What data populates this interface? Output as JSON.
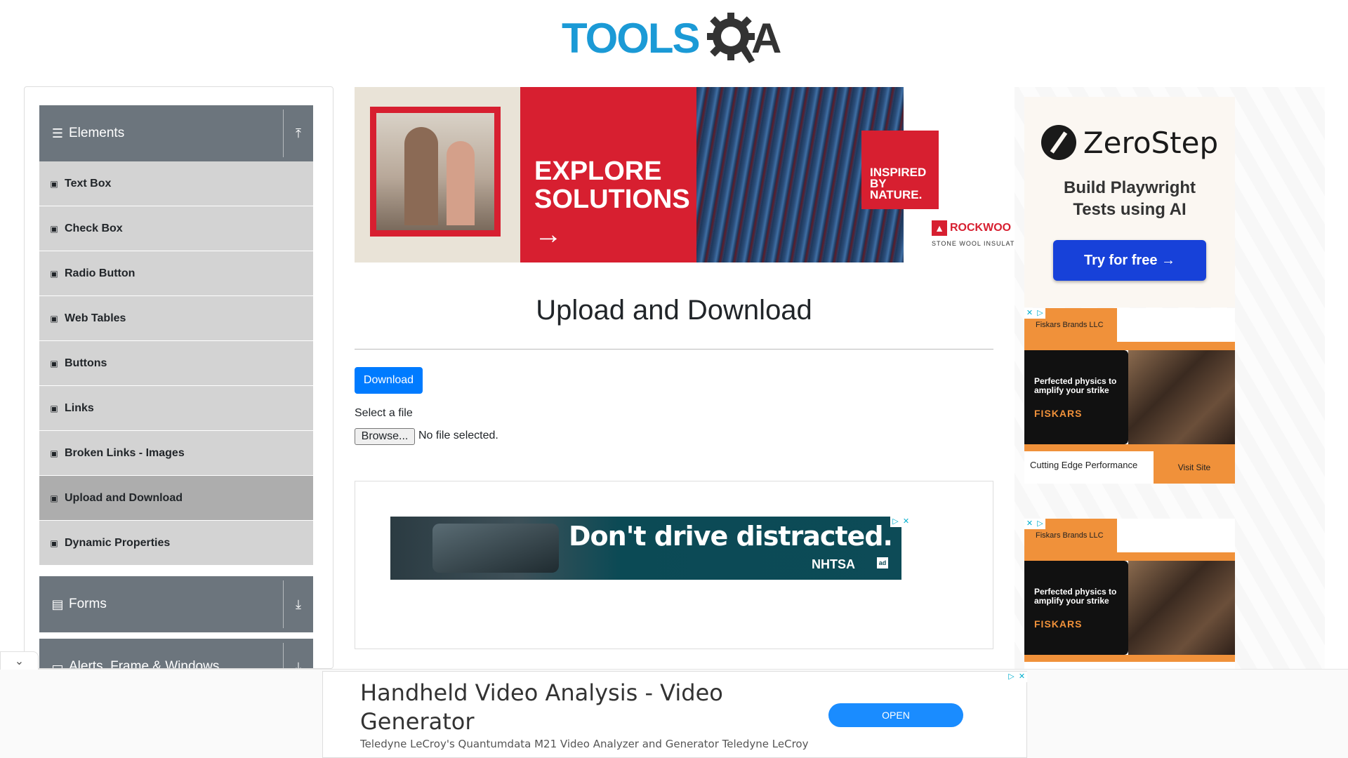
{
  "header": {
    "logo_tools": "TOOLS",
    "logo_a": "A"
  },
  "sidebar": {
    "groups": [
      {
        "label": "Elements",
        "icon": "hamburger-icon",
        "toggle_icon": "arrow-up-icon"
      },
      {
        "label": "Forms",
        "icon": "document-icon",
        "toggle_icon": "arrow-down-icon"
      },
      {
        "label": "Alerts, Frame & Windows",
        "icon": "window-icon",
        "toggle_icon": "arrow-down-icon"
      }
    ],
    "items": [
      {
        "label": "Text Box"
      },
      {
        "label": "Check Box"
      },
      {
        "label": "Radio Button"
      },
      {
        "label": "Web Tables"
      },
      {
        "label": "Buttons"
      },
      {
        "label": "Links"
      },
      {
        "label": "Broken Links - Images"
      },
      {
        "label": "Upload and Download",
        "active": true
      },
      {
        "label": "Dynamic Properties"
      }
    ]
  },
  "banner_ad": {
    "headline_line1": "EXPLORE",
    "headline_line2": "SOLUTIONS",
    "arrow": "→",
    "badge_line1": "INSPIRED",
    "badge_line2": "BY",
    "badge_line3": "NATURE.",
    "brand": "ROCKWOO",
    "tagline": "STONE WOOL INSULATIO",
    "brand_color": "#d71f30"
  },
  "main": {
    "title": "Upload and Download",
    "download_label": "Download",
    "select_label": "Select a file",
    "browse_label": "Browse...",
    "no_file_text": "No file selected.",
    "accent": "#007bff"
  },
  "mid_ad": {
    "headline": "Don't drive distracted.",
    "brand": "NHTSA",
    "ad_badge": "ad"
  },
  "right_ads": {
    "zerostep": {
      "name": "ZeroStep",
      "tagline_line1": "Build Playwright",
      "tagline_line2": "Tests using AI",
      "cta": "Try for free →",
      "cta_color": "#1741d9"
    },
    "fiskars": [
      {
        "advertiser": "Fiskars Brands LLC",
        "line1": "Perfected physics to",
        "line2": "amplify your strike",
        "brand": "FISKARS",
        "caption": "Cutting Edge Performance",
        "cta": "Visit Site"
      },
      {
        "advertiser": "Fiskars Brands LLC",
        "line1": "Perfected physics to",
        "line2": "amplify your strike",
        "brand": "FISKARS",
        "caption": "",
        "cta": ""
      }
    ]
  },
  "anchor_ad": {
    "title": "Handheld Video Analysis - Video Generator",
    "description": "Teledyne LeCroy's Quantumdata M21 Video Analyzer and Generator Teledyne LeCroy",
    "cta": "OPEN"
  }
}
